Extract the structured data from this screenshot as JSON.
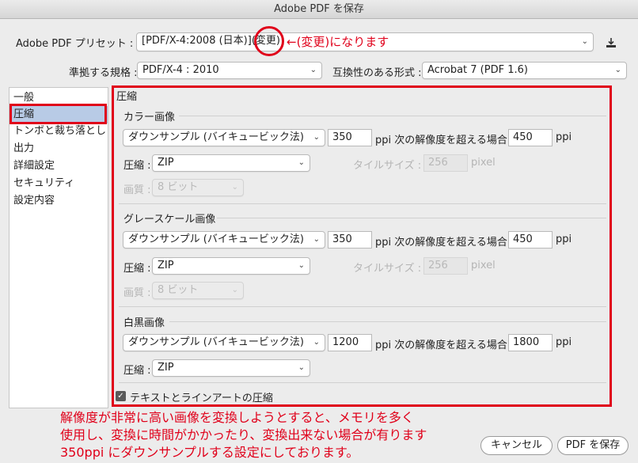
{
  "window": {
    "title": "Adobe PDF を保存"
  },
  "preset": {
    "label": "Adobe PDF プリセット :",
    "value_main": "[PDF/X-4:2008 (日本)]",
    "value_suffix": "(変更)",
    "annotation": "←(変更)になります"
  },
  "standard": {
    "label": "準拠する規格 :",
    "value": "PDF/X-4 : 2010"
  },
  "compat": {
    "label": "互換性のある形式 :",
    "value": "Acrobat 7 (PDF 1.6)"
  },
  "sidebar": {
    "items": [
      {
        "label": "一般"
      },
      {
        "label": "圧縮"
      },
      {
        "label": "トンボと裁ち落とし"
      },
      {
        "label": "出力"
      },
      {
        "label": "詳細設定"
      },
      {
        "label": "セキュリティ"
      },
      {
        "label": "設定内容"
      }
    ]
  },
  "compression": {
    "title": "圧縮",
    "color": {
      "title": "カラー画像",
      "sampling": "ダウンサンプル (バイキュービック法)",
      "ppi": "350",
      "mid_label": "ppi 次の解像度を超える場合",
      "above": "450",
      "unit": "ppi",
      "comp_label": "圧縮 :",
      "comp_value": "ZIP",
      "tile_label": "タイルサイズ :",
      "tile_value": "256",
      "tile_unit": "pixel",
      "quality_label": "画質 :",
      "quality_value": "8 ビット"
    },
    "gray": {
      "title": "グレースケール画像",
      "sampling": "ダウンサンプル (バイキュービック法)",
      "ppi": "350",
      "mid_label": "ppi 次の解像度を超える場合",
      "above": "450",
      "unit": "ppi",
      "comp_label": "圧縮 :",
      "comp_value": "ZIP",
      "tile_label": "タイルサイズ :",
      "tile_value": "256",
      "tile_unit": "pixel",
      "quality_label": "画質 :",
      "quality_value": "8 ビット"
    },
    "mono": {
      "title": "白黒画像",
      "sampling": "ダウンサンプル (バイキュービック法)",
      "ppi": "1200",
      "mid_label": "ppi 次の解像度を超える場合",
      "above": "1800",
      "unit": "ppi",
      "comp_label": "圧縮 :",
      "comp_value": "ZIP"
    },
    "text_art": {
      "label": "テキストとラインアートの圧縮",
      "checked": true
    }
  },
  "note": {
    "line1": "解像度が非常に高い画像を変換しようとすると、メモリを多く",
    "line2": "使用し、変換に時間がかかったり、変換出来ない場合が有ります",
    "line3": "350ppi にダウンサンプルする設定にしております。"
  },
  "buttons": {
    "cancel": "キャンセル",
    "save": "PDF を保存"
  },
  "colors": {
    "annotation_red": "#e0001a",
    "sidebar_selected": "#b8cbe6"
  },
  "icons": {
    "download": "download-icon",
    "chevron": "chevron-down-icon",
    "check": "check-icon"
  }
}
